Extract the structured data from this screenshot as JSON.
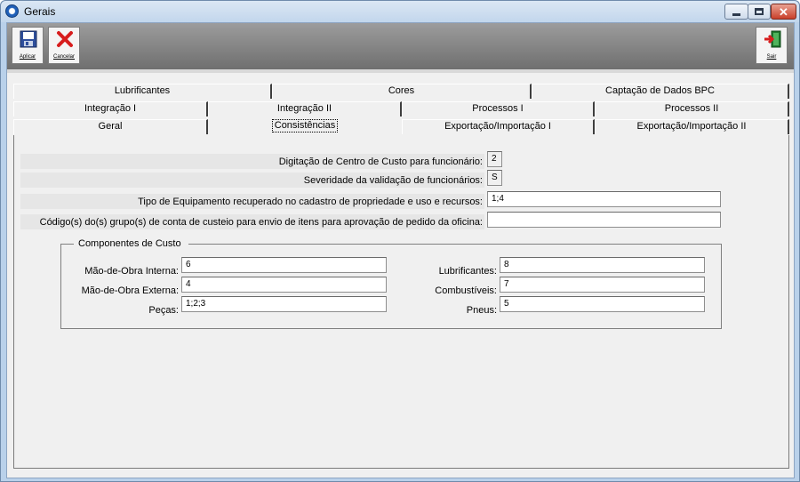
{
  "window": {
    "title": "Gerais"
  },
  "toolbar": {
    "apply_label": "Aplicar",
    "cancel_label": "Cancelar",
    "exit_label": "Sair"
  },
  "tabs": {
    "row1": [
      "Lubrificantes",
      "Cores",
      "Captação de Dados BPC"
    ],
    "row2": [
      "Integração I",
      "Integração II",
      "Processos I",
      "Processos II"
    ],
    "row3": [
      "Geral",
      "Consistências",
      "Exportação/Importação I",
      "Exportação/Importação II"
    ],
    "active": "Consistências"
  },
  "fields": {
    "cost_center": {
      "label": "Digitação de Centro de Custo para funcionário:",
      "value": "2"
    },
    "severity": {
      "label": "Severidade da validação de funcionários:",
      "value": "S"
    },
    "equipment_type": {
      "label": "Tipo de Equipamento recuperado no cadastro de propriedade e uso e recursos:",
      "value": "1;4"
    },
    "account_groups": {
      "label": "Código(s) do(s) grupo(s) de conta de custeio para envio de itens para aprovação de pedido da oficina:",
      "value": ""
    }
  },
  "cost_components": {
    "title": "Componentes de Custo",
    "internal_labor": {
      "label": "Mão-de-Obra Interna:",
      "value": "6"
    },
    "external_labor": {
      "label": "Mão-de-Obra Externa:",
      "value": "4"
    },
    "parts": {
      "label": "Peças:",
      "value": "1;2;3"
    },
    "lubricants": {
      "label": "Lubrificantes:",
      "value": "8"
    },
    "fuels": {
      "label": "Combustíveis:",
      "value": "7"
    },
    "tires": {
      "label": "Pneus:",
      "value": "5"
    }
  },
  "colors": {
    "accent": "#b9d1ea",
    "close_button": "#c9402a"
  }
}
